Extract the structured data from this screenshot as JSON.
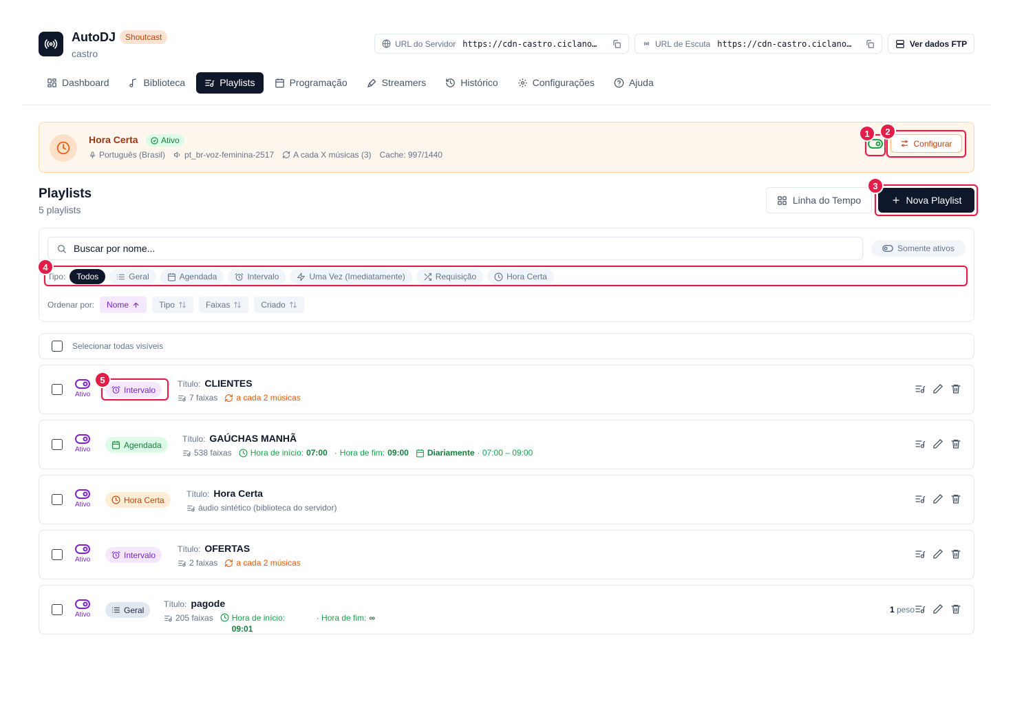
{
  "app": {
    "title": "AutoDJ",
    "badge": "Shoutcast",
    "subtitle": "castro"
  },
  "header": {
    "server_url_label": "URL do Servidor",
    "server_url_value": "https://cdn-castro.ciclano…",
    "listen_url_label": "URL de Escuta",
    "listen_url_value": "https://cdn-castro.ciclano…",
    "ftp_label": "Ver dados FTP"
  },
  "nav": [
    {
      "label": "Dashboard",
      "icon": "grid-icon"
    },
    {
      "label": "Biblioteca",
      "icon": "music-note-icon"
    },
    {
      "label": "Playlists",
      "icon": "playlist-icon",
      "active": true
    },
    {
      "label": "Programação",
      "icon": "calendar-icon"
    },
    {
      "label": "Streamers",
      "icon": "mic-icon"
    },
    {
      "label": "Histórico",
      "icon": "history-icon"
    },
    {
      "label": "Configurações",
      "icon": "gear-icon"
    },
    {
      "label": "Ajuda",
      "icon": "help-icon"
    }
  ],
  "banner": {
    "title": "Hora Certa",
    "status": "Ativo",
    "language": "Português (Brasil)",
    "voice": "pt_br-voz-feminina-2517",
    "frequency": "A cada X músicas (3)",
    "cache": "Cache: 997/1440",
    "config_label": "Configurar"
  },
  "markers": [
    "1",
    "2",
    "3",
    "4",
    "5"
  ],
  "playlists_section": {
    "title": "Playlists",
    "count": "5 playlists",
    "timeline_label": "Linha do Tempo",
    "new_label": "Nova Playlist"
  },
  "filters": {
    "search_placeholder": "Buscar por nome...",
    "only_active": "Somente ativos",
    "type_label": "Tipo:",
    "types": [
      {
        "label": "Todos",
        "active": true
      },
      {
        "label": "Geral",
        "icon": "list-icon"
      },
      {
        "label": "Agendada",
        "icon": "calendar-icon"
      },
      {
        "label": "Intervalo",
        "icon": "alarm-icon"
      },
      {
        "label": "Uma Vez (Imediatamente)",
        "icon": "bolt-icon"
      },
      {
        "label": "Requisição",
        "icon": "shuffle-icon"
      },
      {
        "label": "Hora Certa",
        "icon": "clock-icon"
      }
    ],
    "sort_label": "Ordenar por:",
    "sorts": [
      {
        "label": "Nome",
        "active": true
      },
      {
        "label": "Tipo"
      },
      {
        "label": "Faixas"
      },
      {
        "label": "Criado"
      }
    ]
  },
  "select_all_label": "Selecionar todas visíveis",
  "rows_common": {
    "status": "Ativo",
    "title_label": "Título:"
  },
  "rows": [
    {
      "type": "Intervalo",
      "title": "CLIENTES",
      "tracks": "7 faixas",
      "extra": "a cada 2 músicas"
    },
    {
      "type": "Agendada",
      "title": "GAÚCHAS MANHÃ",
      "tracks": "538 faixas",
      "start_label": "Hora de início:",
      "start": "07:00",
      "end_label": "Hora de fim:",
      "end": "09:00",
      "recurrence": "Diariamente",
      "range": "· 07:00 – 09:00"
    },
    {
      "type": "Hora Certa",
      "title": "Hora Certa",
      "tracks": "áudio sintético (biblioteca do servidor)"
    },
    {
      "type": "Intervalo",
      "title": "OFERTAS",
      "tracks": "2 faixas",
      "extra": "a cada 2 músicas"
    },
    {
      "type": "Geral",
      "title": "pagode",
      "tracks": "205 faixas",
      "start_label": "Hora de início:",
      "start": "09:01",
      "end_label": "· Hora de fim:",
      "end": "∞",
      "peso_value": "1",
      "peso_label": "peso"
    }
  ],
  "colors": {
    "primary": "#0f172a",
    "highlight": "#e11d48",
    "purple": "#7e22ce",
    "green": "#15803d",
    "orange": "#c2410c"
  }
}
